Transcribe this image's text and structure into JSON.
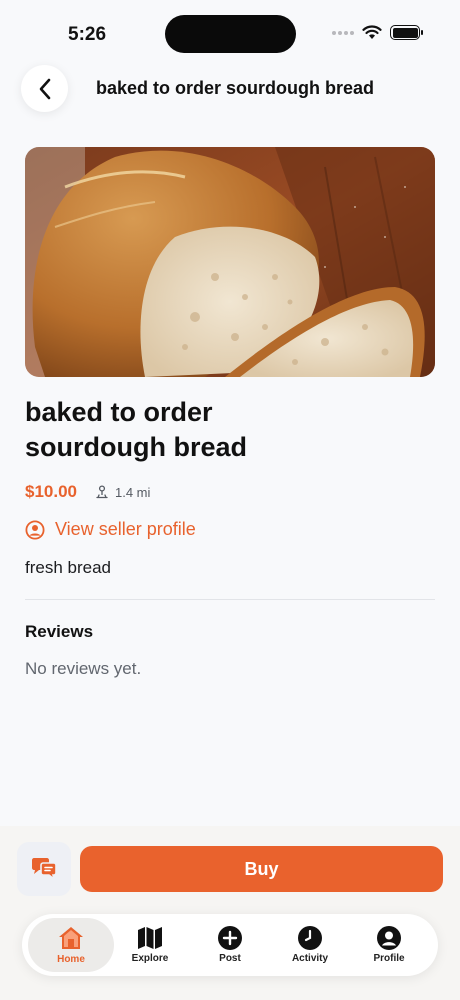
{
  "status_bar": {
    "time": "5:26"
  },
  "header": {
    "title": "baked to order sourdough bread"
  },
  "product": {
    "title": "baked to order sourdough bread",
    "price": "$10.00",
    "distance": "1.4 mi",
    "seller_link": "View seller profile",
    "description": "fresh bread"
  },
  "reviews": {
    "heading": "Reviews",
    "empty_text": "No reviews yet."
  },
  "actions": {
    "buy_label": "Buy"
  },
  "tabs": [
    {
      "label": "Home",
      "icon": "home-icon",
      "active": true
    },
    {
      "label": "Explore",
      "icon": "map-icon",
      "active": false
    },
    {
      "label": "Post",
      "icon": "plus-circle-icon",
      "active": false
    },
    {
      "label": "Activity",
      "icon": "clock-icon",
      "active": false
    },
    {
      "label": "Profile",
      "icon": "user-circle-icon",
      "active": false
    }
  ],
  "colors": {
    "accent": "#e8622d",
    "background": "#f8f9fb",
    "text": "#1c1d20"
  }
}
